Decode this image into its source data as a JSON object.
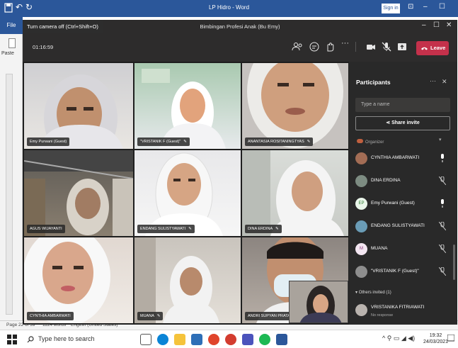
{
  "word": {
    "title": "LP Hidro - Word",
    "signin": "Sign in",
    "file_tab": "File",
    "paste_label": "Paste",
    "status": {
      "page": "Page 22 of 39",
      "words": "1124 words",
      "language": "English (United States)"
    }
  },
  "teams": {
    "tooltip": "Turn camera off (Ctrl+Shift+O)",
    "meeting_title": "Bimbingan Profesi Anak (Bu Emy)",
    "timer": "01:16:59",
    "leave_label": "Leave",
    "tiles": [
      {
        "label": "Emy Purwani (Guest)",
        "pinned": false
      },
      {
        "label": "\"VRISTANIK F (Guest)\"",
        "pinned": true
      },
      {
        "label": "ANANTASIA ROSITANINGTYAS",
        "pinned": true
      },
      {
        "label": "AGUS WIJAYANTI",
        "pinned": false
      },
      {
        "label": "ENDANG SULISTYAWATI",
        "pinned": true
      },
      {
        "label": "DINA ERDINA",
        "pinned": true
      },
      {
        "label": "CYNTHIA AMBARWATI",
        "pinned": false
      },
      {
        "label": "MUANA",
        "pinned": true
      },
      {
        "label": "ANDRI SUPYAN PRATAMA",
        "pinned": false
      }
    ],
    "participants": {
      "title": "Participants",
      "search_placeholder": "Type a name",
      "share_invite": "Share invite",
      "organizer_label": "Organizer",
      "list": [
        {
          "name": "CYNTHIA AMBARWATI",
          "initials": "",
          "muted": false
        },
        {
          "name": "DINA ERDINA",
          "initials": "",
          "muted": true
        },
        {
          "name": "Emy Purwani (Guest)",
          "initials": "EP",
          "muted": false
        },
        {
          "name": "ENDANG SULISTYAWATI",
          "initials": "",
          "muted": true
        },
        {
          "name": "MUANA",
          "initials": "M",
          "muted": true
        },
        {
          "name": "\"VRISTANIK F (Guest)\"",
          "initials": "",
          "muted": true
        }
      ],
      "others_invited": "Others invited (1)",
      "invited": {
        "name": "VRISTANIKA FITRIAWATI",
        "status": "No response"
      }
    }
  },
  "taskbar": {
    "search_placeholder": "Type here to search",
    "time": "19:32",
    "date": "24/03/2021"
  }
}
